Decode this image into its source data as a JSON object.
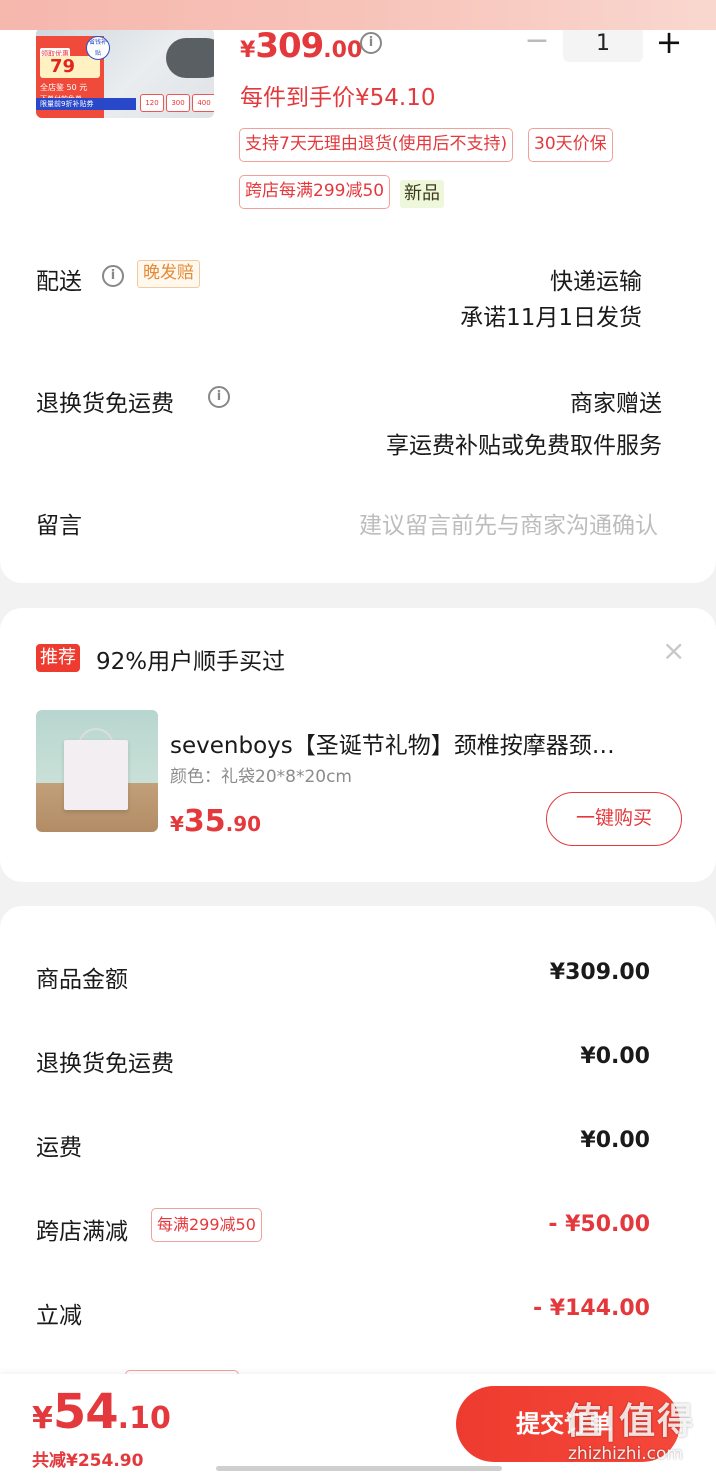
{
  "product": {
    "price_yen": "¥",
    "price_int": "309",
    "price_dec": ".00",
    "unit_price": "每件到手价¥54.10",
    "quantity": "1",
    "minus": "−",
    "plus": "+",
    "info": "i",
    "thumb": {
      "t1": "领取优惠券",
      "t2": "79",
      "t3": "全店鉴 50 元",
      "t4": "下单付款免单",
      "t5": "限量前9折补贴券",
      "badge": "省钱补贴",
      "m1": "120",
      "m2": "300",
      "m3": "400"
    },
    "tags": [
      "支持7天无理由退货(使用后不支持)",
      "30天价保",
      "跨店每满299减50"
    ],
    "new_tag": "新品"
  },
  "delivery": {
    "label": "配送",
    "late_badge": "晚发赔",
    "method": "快递运输",
    "promise": "承诺11月1日发货"
  },
  "return_shipping": {
    "label": "退换货免运费",
    "value1": "商家赠送",
    "value2": "享运费补贴或免费取件服务"
  },
  "message": {
    "label": "留言",
    "placeholder": "建议留言前先与商家沟通确认"
  },
  "recommend": {
    "badge": "推荐",
    "text": "92%用户顺手买过",
    "close": "×",
    "title": "sevenboys【圣诞节礼物】颈椎按摩器颈…",
    "sku": "颜色：礼袋20*8*20cm",
    "price_yen": "¥",
    "price_int": "35",
    "price_dec": ".90",
    "buy": "一键购买"
  },
  "summary": {
    "rows": [
      {
        "label": "商品金额",
        "value": "¥309.00"
      },
      {
        "label": "退换货免运费",
        "value": "¥0.00"
      },
      {
        "label": "运费",
        "value": "¥0.00"
      },
      {
        "label": "跨店满减",
        "tag": "每满299减50",
        "value": "- ¥50.00"
      },
      {
        "label": "立减",
        "value": "- ¥144.00"
      }
    ]
  },
  "footer": {
    "total_yen": "¥",
    "total_int": "54",
    "total_dec": ".10",
    "saved": "共减¥254.90",
    "submit": "提交订单",
    "watermark": "值|值得",
    "watermark_url": "zhizhizhi.com"
  },
  "colors": {
    "accent": "#e4393c",
    "brand_red": "#ee3b2f"
  }
}
